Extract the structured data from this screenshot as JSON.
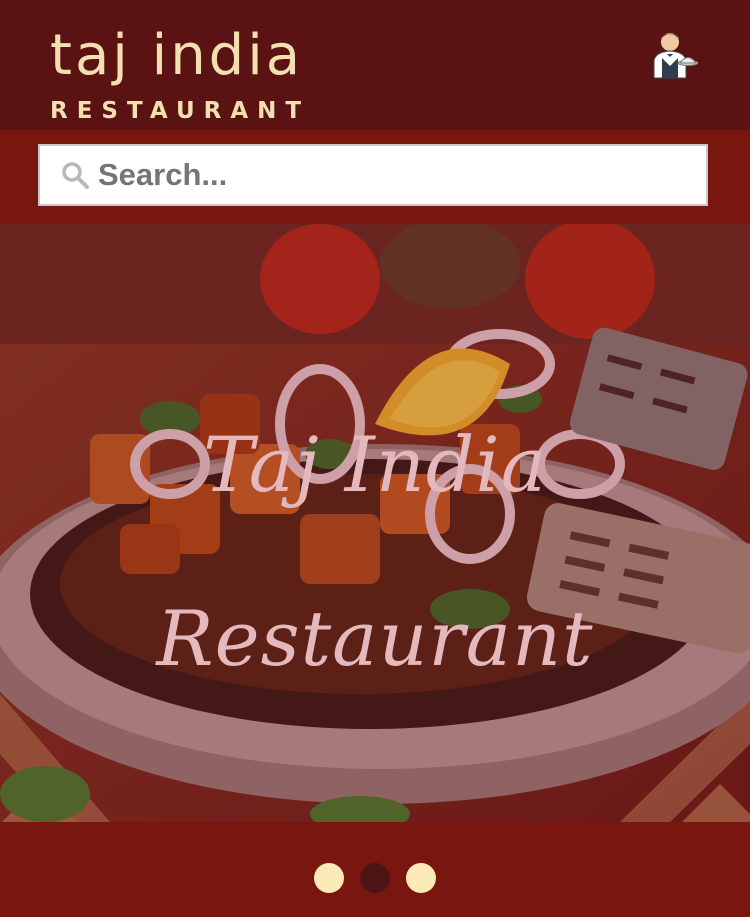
{
  "header": {
    "logo_title": "taj india",
    "logo_subtitle": "RESTAURANT",
    "waiter_icon": "waiter-icon"
  },
  "search": {
    "placeholder": "Search...",
    "icon": "search-icon"
  },
  "hero": {
    "line1": "Taj India",
    "line2": "Restaurant"
  },
  "carousel": {
    "slide_count": 3,
    "active_index": 1,
    "dot_color": "#fbeab5",
    "active_dot_color": "#4d1416"
  },
  "colors": {
    "header_bg": "#5a1212",
    "bar_bg": "#7a1610",
    "logo_color": "#f3dfb2"
  }
}
